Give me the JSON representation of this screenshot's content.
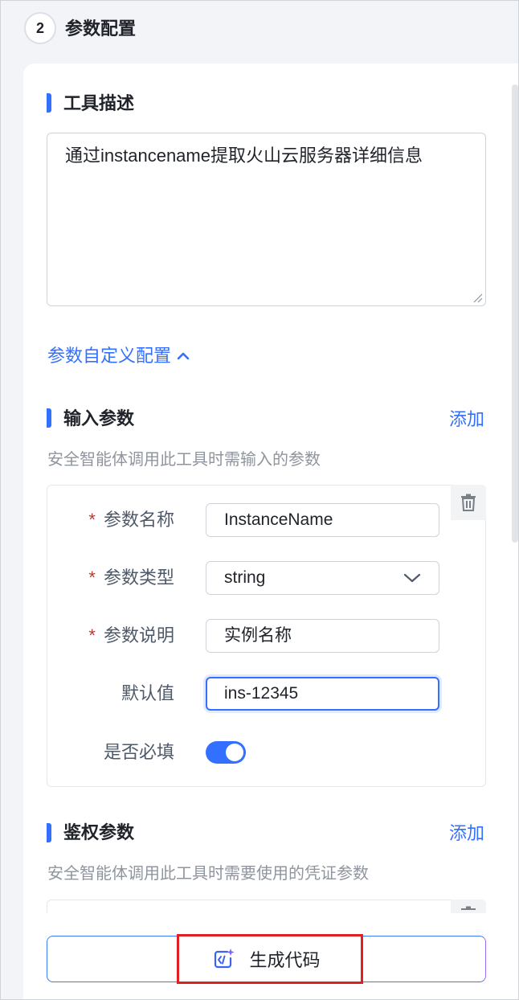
{
  "step": {
    "number": "2",
    "title": "参数配置"
  },
  "tool_description": {
    "title": "工具描述",
    "value": "通过instancename提取火山云服务器详细信息"
  },
  "custom_params_toggle": {
    "label": "参数自定义配置",
    "icon": "chevron-up-icon"
  },
  "input_params": {
    "title": "输入参数",
    "add_label": "添加",
    "description": "安全智能体调用此工具时需输入的参数",
    "fields": {
      "name": {
        "label": "参数名称",
        "required": true,
        "value": "InstanceName"
      },
      "type": {
        "label": "参数类型",
        "required": true,
        "value": "string"
      },
      "desc": {
        "label": "参数说明",
        "required": true,
        "value": "实例名称"
      },
      "default": {
        "label": "默认值",
        "required": false,
        "value": "ins-12345"
      },
      "is_required": {
        "label": "是否必填",
        "on": true
      }
    },
    "required_mark": "*"
  },
  "auth_params": {
    "title": "鉴权参数",
    "add_label": "添加",
    "description": "安全智能体调用此工具时需要使用的凭证参数"
  },
  "generate_button": {
    "label": "生成代码",
    "icon": "ai-code-icon"
  },
  "colors": {
    "accent": "#3370ff",
    "required": "#c0392b",
    "highlight": "#e02020"
  }
}
